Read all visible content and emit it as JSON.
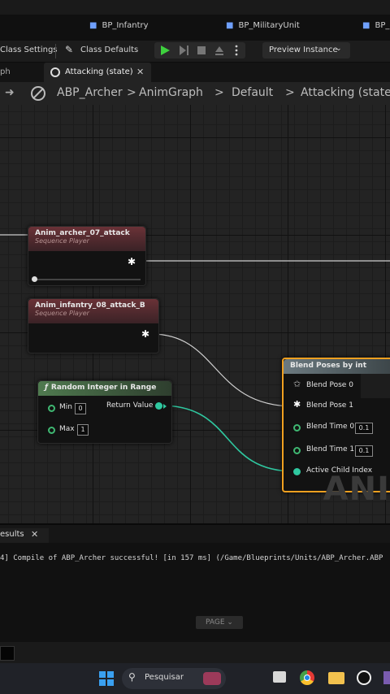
{
  "asset_tabs": [
    "BP_Infantry",
    "BP_MilitaryUnit",
    "BP_"
  ],
  "toolbar": {
    "class_settings": "Class Settings",
    "class_defaults": "Class Defaults",
    "preview_instance": "Preview Instance"
  },
  "graph_tabs": {
    "partial": "ph",
    "active": "Attacking (state)"
  },
  "breadcrumb": [
    "ABP_Archer",
    "AnimGraph",
    "Default",
    "Attacking (state)"
  ],
  "nodes": {
    "seq1": {
      "title": "Anim_archer_07_attack",
      "subtitle": "Sequence Player"
    },
    "seq2": {
      "title": "Anim_infantry_08_attack_B",
      "subtitle": "Sequence Player"
    },
    "random": {
      "title": "Random Integer in Range",
      "min_label": "Min",
      "min_value": "0",
      "max_label": "Max",
      "max_value": "1",
      "return_label": "Return Value"
    },
    "blend": {
      "title": "Blend Poses by int",
      "pose0": "Blend Pose 0",
      "pose1": "Blend Pose 1",
      "time0_label": "Blend Time 0",
      "time0_value": "0.1",
      "time1_label": "Blend Time 1",
      "time1_value": "0.1",
      "active_child": "Active Child Index"
    }
  },
  "watermark": "ANI",
  "log": {
    "tab_label": "esults",
    "line": "4] Compile of ABP_Archer successful! [in 157 ms] (/Game/Blueprints/Units/ABP_Archer.ABP",
    "page_button": "PAGE"
  },
  "taskbar": {
    "search_placeholder": "Pesquisar"
  },
  "colors": {
    "accent": "#f0a020",
    "exec_green": "#3fb872",
    "seq_header": "#5a2e32",
    "func_header": "#3d5a3d"
  }
}
